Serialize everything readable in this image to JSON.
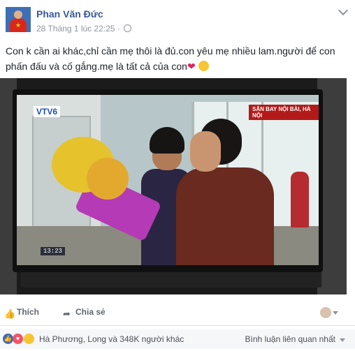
{
  "post": {
    "author": "Phan Văn Đức",
    "timestamp": "28 Tháng 1 lúc 22:25",
    "separator": "·",
    "text_line1": "Con k cần ai khác,chỉ cần mẹ thôi là đủ.con yêu mẹ nhiều lam.người để con",
    "text_line2": "phấn đấu và cố gắng.mẹ là tất cả của con",
    "heart": "❤",
    "photo": {
      "tv_logo": "VTV6",
      "location_caption": "SÂN BAY NỘI BÀI, HÀ NỘI",
      "clock": "13:23"
    }
  },
  "actions": {
    "like_label": "Thích",
    "share_label": "Chia sẻ"
  },
  "reactions": {
    "summary": "Hà Phương, Long và 348K người khác",
    "sort_label": "Bình luận liên quan nhất"
  },
  "colors": {
    "link_blue": "#365899",
    "meta_gray": "#90949c",
    "text": "#1d2129",
    "like_blue": "#4267b2",
    "love_red": "#f25268"
  },
  "icons": [
    "globe-icon",
    "chevron-down-icon",
    "like-icon",
    "share-icon",
    "heart-emoji",
    "smile-emoji",
    "sad-emoji"
  ]
}
